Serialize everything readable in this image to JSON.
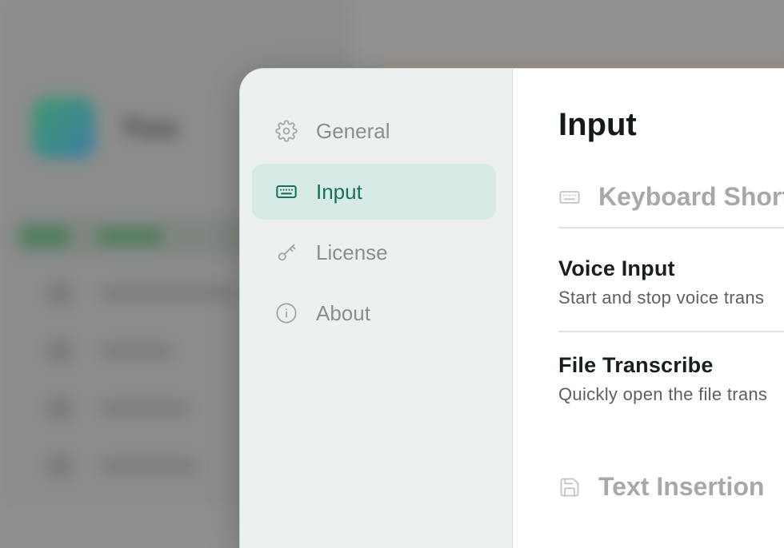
{
  "background_app": {
    "title": "Yoo"
  },
  "sidebar": {
    "items": [
      {
        "label": "General",
        "icon": "gear-icon",
        "active": false
      },
      {
        "label": "Input",
        "icon": "keyboard-icon",
        "active": true
      },
      {
        "label": "License",
        "icon": "key-icon",
        "active": false
      },
      {
        "label": "About",
        "icon": "info-icon",
        "active": false
      }
    ]
  },
  "main": {
    "title": "Input",
    "sections": [
      {
        "heading": "Keyboard Short",
        "icon": "keyboard-icon"
      },
      {
        "heading": "Text Insertion",
        "icon": "save-icon"
      }
    ],
    "settings": [
      {
        "name": "Voice Input",
        "description": "Start and stop voice trans"
      },
      {
        "name": "File Transcribe",
        "description": "Quickly open the file trans"
      }
    ]
  },
  "colors": {
    "accent": "#1b6e5c",
    "active_bg": "#d7ebe6",
    "sidebar_bg": "#ecf1ef"
  }
}
